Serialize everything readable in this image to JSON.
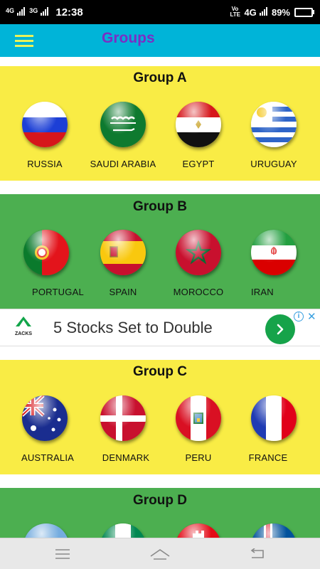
{
  "status_bar": {
    "time": "12:38",
    "network_1": "4G",
    "network_2": "3G",
    "volte_label": "Vo LTE",
    "network_3": "4G",
    "battery_text": "89%",
    "battery_level": 0.89
  },
  "app_bar": {
    "title": "Groups",
    "menu_icon": "hamburger-menu-icon"
  },
  "groups": [
    {
      "title": "Group A",
      "teams": [
        {
          "name": "RUSSIA",
          "flag": "russia-flag-icon"
        },
        {
          "name": "SAUDI ARABIA",
          "flag": "saudi-arabia-flag-icon"
        },
        {
          "name": "EGYPT",
          "flag": "egypt-flag-icon"
        },
        {
          "name": "URUGUAY",
          "flag": "uruguay-flag-icon"
        }
      ]
    },
    {
      "title": "Group B",
      "teams": [
        {
          "name": "PORTUGAL",
          "flag": "portugal-flag-icon"
        },
        {
          "name": "SPAIN",
          "flag": "spain-flag-icon"
        },
        {
          "name": "MOROCCO",
          "flag": "morocco-flag-icon"
        },
        {
          "name": "IRAN",
          "flag": "iran-flag-icon"
        }
      ]
    },
    {
      "title": "Group C",
      "teams": [
        {
          "name": "AUSTRALIA",
          "flag": "australia-flag-icon"
        },
        {
          "name": "DENMARK",
          "flag": "denmark-flag-icon"
        },
        {
          "name": "PERU",
          "flag": "peru-flag-icon"
        },
        {
          "name": "FRANCE",
          "flag": "france-flag-icon"
        }
      ]
    },
    {
      "title": "Group D",
      "teams": [
        {
          "flag": "argentina-flag-icon"
        },
        {
          "flag": "nigeria-flag-icon"
        },
        {
          "flag": "croatia-flag-icon"
        },
        {
          "flag": "iceland-flag-icon"
        }
      ]
    }
  ],
  "ad": {
    "brand": "ZACKS",
    "text": "5 Stocks Set to Double",
    "cta_icon": "chevron-right-icon",
    "info_icon": "info-icon",
    "close_icon": "close-icon"
  },
  "nav_bar": {
    "menu_icon": "nav-menu-icon",
    "home_icon": "home-icon",
    "back_icon": "back-icon"
  },
  "colors": {
    "app_bar": "#00b4d8",
    "title": "#7a2ec4",
    "group_yellow": "#f9ec45",
    "group_green": "#4caf50",
    "ad_button": "#16a34a"
  }
}
